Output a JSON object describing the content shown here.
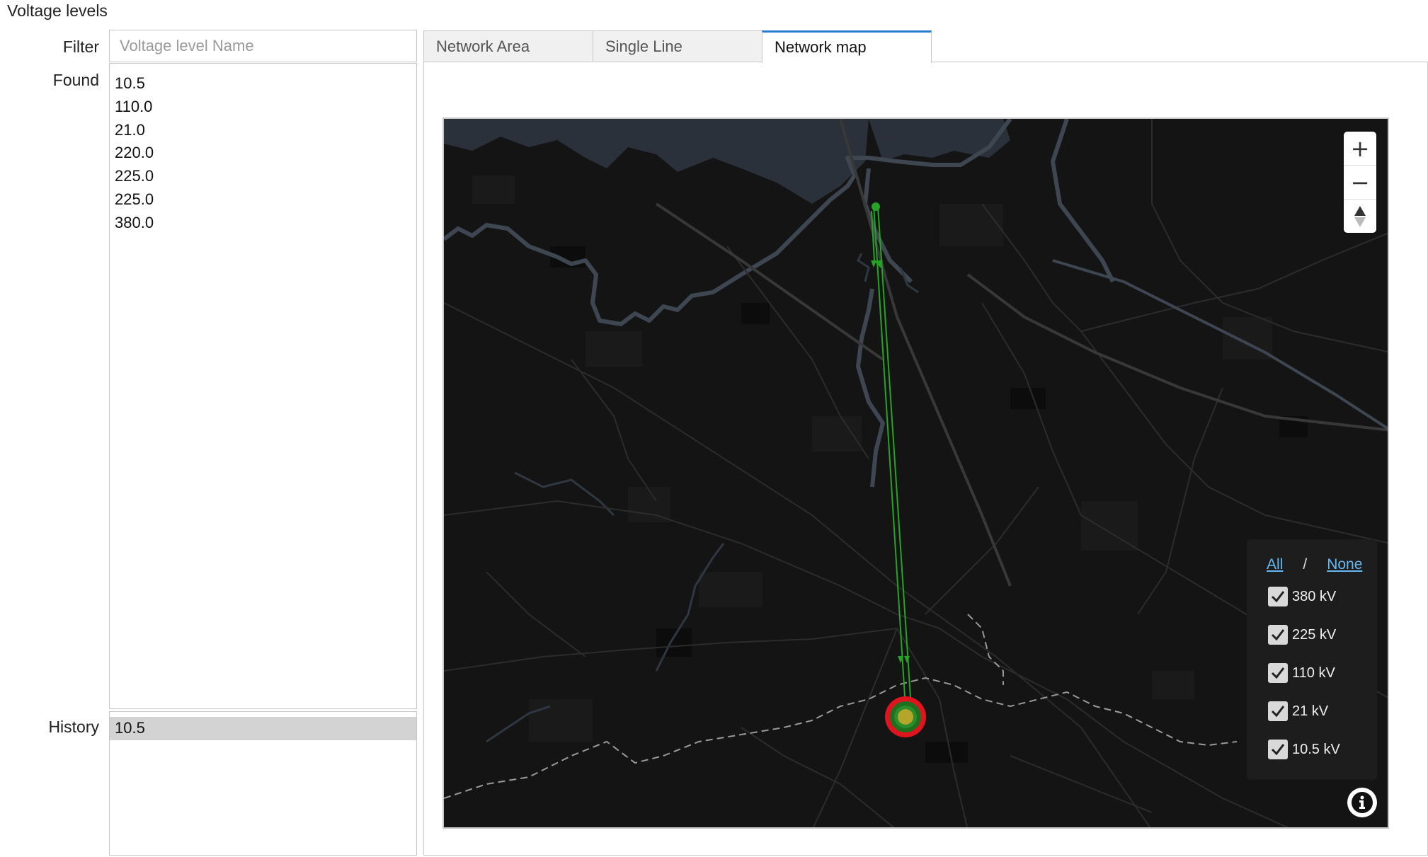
{
  "section_title": "Voltage levels",
  "filter": {
    "label": "Filter",
    "placeholder": "Voltage level Name",
    "value": ""
  },
  "found": {
    "label": "Found",
    "items": [
      "10.5",
      "110.0",
      "21.0",
      "220.0",
      "225.0",
      "225.0",
      "380.0"
    ]
  },
  "history": {
    "label": "History",
    "items": [
      "10.5"
    ],
    "selected": "10.5"
  },
  "tabs": [
    {
      "label": "Network Area",
      "active": false
    },
    {
      "label": "Single Line",
      "active": false
    },
    {
      "label": "Network map",
      "active": true
    }
  ],
  "map": {
    "zoom_in": "+",
    "zoom_out": "−",
    "compass": "north-arrow-icon",
    "info": "info-icon",
    "legend": {
      "all": "All",
      "separator": "/",
      "none": "None",
      "items": [
        {
          "label": "380 kV",
          "checked": true
        },
        {
          "label": "225 kV",
          "checked": true
        },
        {
          "label": "110 kV",
          "checked": true
        },
        {
          "label": "21 kV",
          "checked": true
        },
        {
          "label": "10.5 kV",
          "checked": true
        }
      ]
    },
    "colors": {
      "background": "#141414",
      "water": "#2b313a",
      "roads": "#2e2e2e",
      "line": "#22a322",
      "substation_outer": "#e0141e",
      "substation_inner": "#b3a62a"
    }
  }
}
